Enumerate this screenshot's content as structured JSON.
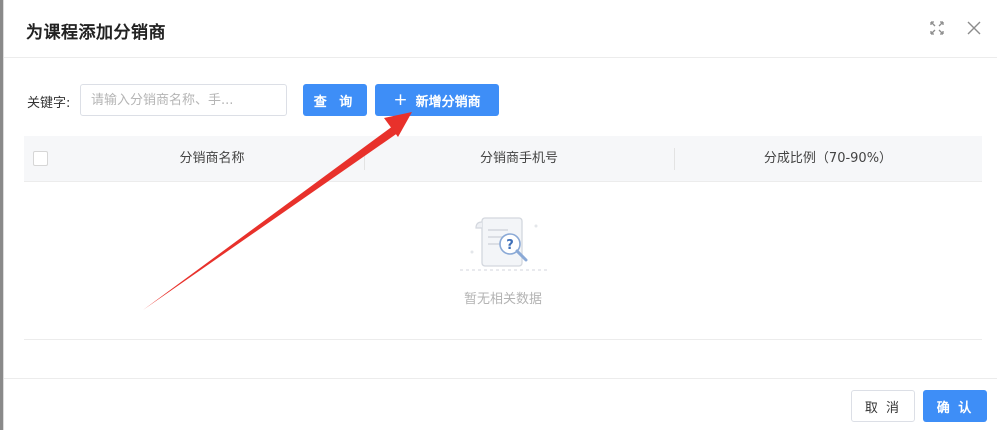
{
  "dialog": {
    "title": "为课程添加分销商",
    "icons": {
      "maximize": "maximize-icon",
      "close": "close-icon"
    }
  },
  "search": {
    "label": "关键字:",
    "placeholder": "请输入分销商名称、手...",
    "value": "",
    "query_label": "查 询",
    "add_label": "新增分销商",
    "add_icon": "plus-icon"
  },
  "table": {
    "columns": [
      "分销商名称",
      "分销商手机号",
      "分成比例（70-90%）"
    ],
    "rows": [],
    "empty_text": "暂无相关数据",
    "empty_icon": "empty-document-search-icon"
  },
  "footer": {
    "cancel_label": "取 消",
    "ok_label": "确 认"
  },
  "colors": {
    "primary": "#3e8ef7",
    "annotation_arrow": "#e8312b",
    "header_bg": "#f6f7f9"
  }
}
